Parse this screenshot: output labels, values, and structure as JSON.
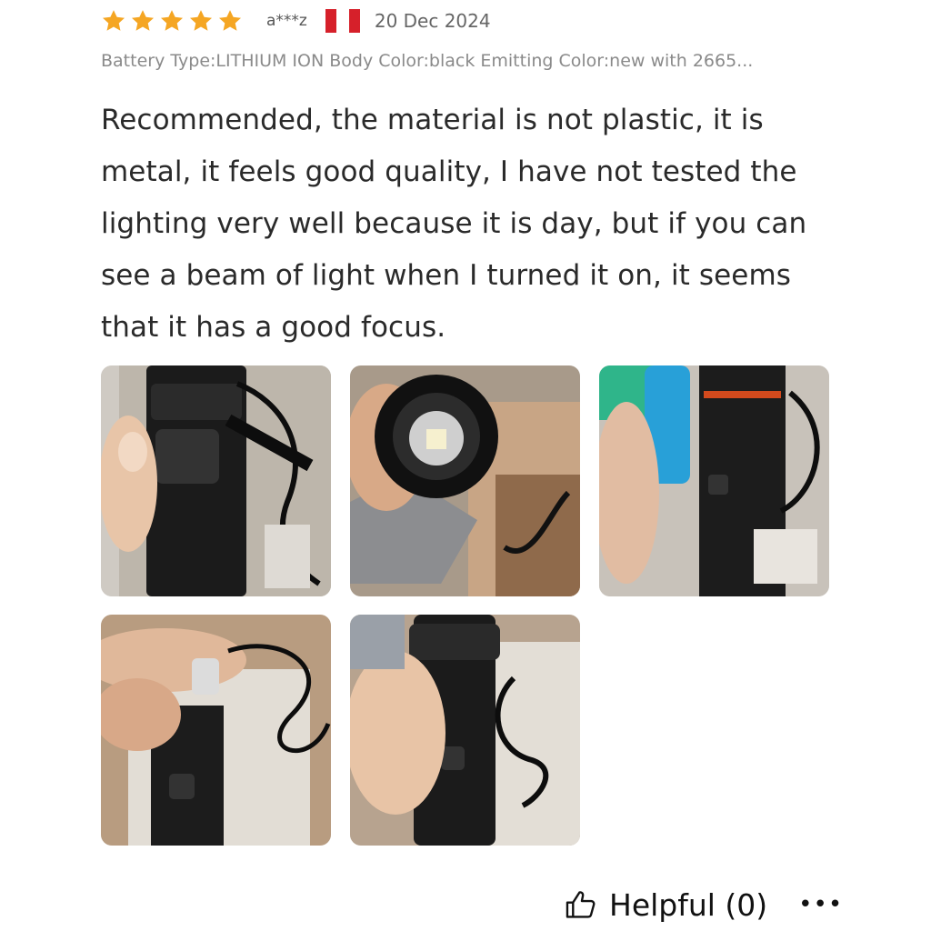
{
  "review": {
    "rating": 5,
    "rating_max": 5,
    "user": "a***z",
    "country_flag_colors": [
      "#d6202a",
      "#ffffff",
      "#d6202a"
    ],
    "date": "20 Dec 2024",
    "attributes": "Battery Type:LITHIUM ION Body Color:black Emitting Color:new with 2665...",
    "text": "Recommended, the material is not plastic, it is metal, it feels good quality, I have not tested the lighting very well because it is day, but if you can see a beam of light when I turned it on, it seems that it has a good focus.",
    "photos": [
      "flashlight-in-box",
      "flashlight-lens-high-power-led",
      "flashlight-with-battery",
      "usb-cable-in-hand",
      "flashlight-held-in-box"
    ]
  },
  "footer": {
    "helpful_label": "Helpful (0)",
    "more_label": "•••"
  },
  "colors": {
    "star": "#f5a623",
    "text": "#2a2a2a",
    "muted": "#8a8a8a"
  }
}
